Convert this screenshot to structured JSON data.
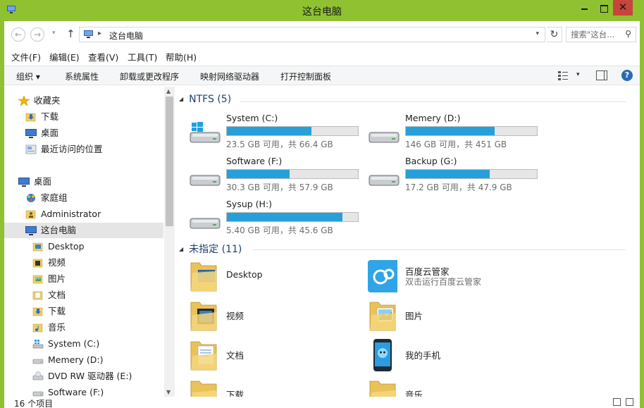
{
  "window": {
    "title": "这台电脑",
    "close_symbol": "✕"
  },
  "nav": {
    "back": "←",
    "forward": "→",
    "recent": "▾",
    "up": "↑",
    "address": {
      "path": "这台电脑",
      "separator": "▸",
      "dropdown": "▾"
    },
    "refresh": "↻",
    "search_placeholder": "搜索\"这台...",
    "search_icon": "⚲"
  },
  "menubar": [
    "文件(F)",
    "编辑(E)",
    "查看(V)",
    "工具(T)",
    "帮助(H)"
  ],
  "command_bar": {
    "organize": "组织 ▾",
    "items": [
      "系统属性",
      "卸载或更改程序",
      "映射网络驱动器",
      "打开控制面板"
    ],
    "view_dropdown": "▾",
    "help": "?"
  },
  "sidebar": {
    "items": [
      {
        "label": "收藏夹",
        "icon": "star-icon"
      },
      {
        "label": "下载",
        "icon": "download-folder-icon"
      },
      {
        "label": "桌面",
        "icon": "desktop-icon"
      },
      {
        "label": "最近访问的位置",
        "icon": "recent-places-icon"
      },
      {
        "label": "桌面",
        "icon": "desktop-icon"
      },
      {
        "label": "家庭组",
        "icon": "homegroup-icon"
      },
      {
        "label": "Administrator",
        "icon": "user-folder-icon"
      },
      {
        "label": "这台电脑",
        "icon": "computer-icon",
        "selected": true
      },
      {
        "label": "Desktop",
        "icon": "folder-icon"
      },
      {
        "label": "视频",
        "icon": "videos-folder-icon"
      },
      {
        "label": "图片",
        "icon": "pictures-folder-icon"
      },
      {
        "label": "文档",
        "icon": "documents-folder-icon"
      },
      {
        "label": "下载",
        "icon": "download-folder-icon"
      },
      {
        "label": "音乐",
        "icon": "music-folder-icon"
      },
      {
        "label": "System (C:)",
        "icon": "system-drive-icon"
      },
      {
        "label": "Memery (D:)",
        "icon": "drive-icon"
      },
      {
        "label": "DVD RW 驱动器 (E:)",
        "icon": "dvd-drive-icon"
      },
      {
        "label": "Software (F:)",
        "icon": "drive-icon"
      }
    ],
    "scroll_up": "▲",
    "scroll_down": "▼"
  },
  "groups": {
    "ntfs": {
      "title": "NTFS (5)"
    },
    "unassigned": {
      "title": "未指定 (11)"
    },
    "collapse_glyph": "◢"
  },
  "drives": [
    {
      "name": "System (C:)",
      "free_text": "23.5 GB 可用，共 66.4 GB",
      "used_fraction": 0.646,
      "icon": "windows-drive-icon"
    },
    {
      "name": "Memery (D:)",
      "free_text": "146 GB 可用，共 451 GB",
      "used_fraction": 0.676,
      "icon": "hard-drive-icon"
    },
    {
      "name": "Software (F:)",
      "free_text": "30.3 GB 可用，共 57.9 GB",
      "used_fraction": 0.477,
      "icon": "hard-drive-icon"
    },
    {
      "name": "Backup (G:)",
      "free_text": "17.2 GB 可用，共 47.9 GB",
      "used_fraction": 0.641,
      "icon": "hard-drive-icon"
    },
    {
      "name": "Sysup (H:)",
      "free_text": "5.40 GB 可用，共 45.6 GB",
      "used_fraction": 0.882,
      "icon": "hard-drive-icon"
    }
  ],
  "folders": [
    {
      "name": "Desktop",
      "subtitle": "",
      "icon": "desktop-folder-icon"
    },
    {
      "name": "百度云管家",
      "subtitle": "双击运行百度云管家",
      "icon": "baidu-cloud-icon"
    },
    {
      "name": "视频",
      "subtitle": "",
      "icon": "videos-folder-icon"
    },
    {
      "name": "图片",
      "subtitle": "",
      "icon": "pictures-folder-icon"
    },
    {
      "name": "文档",
      "subtitle": "",
      "icon": "documents-folder-icon"
    },
    {
      "name": "我的手机",
      "subtitle": "",
      "icon": "phone-icon"
    },
    {
      "name": "下载",
      "subtitle": "",
      "icon": "download-folder-icon"
    },
    {
      "name": "音乐",
      "subtitle": "",
      "icon": "music-folder-icon"
    }
  ],
  "status": {
    "item_count": "16 个项目"
  },
  "colors": {
    "title_bar": "#8fc130",
    "close_button": "#c7453a",
    "usage_bar": "#26a0da",
    "group_header": "#1e3f6e"
  }
}
